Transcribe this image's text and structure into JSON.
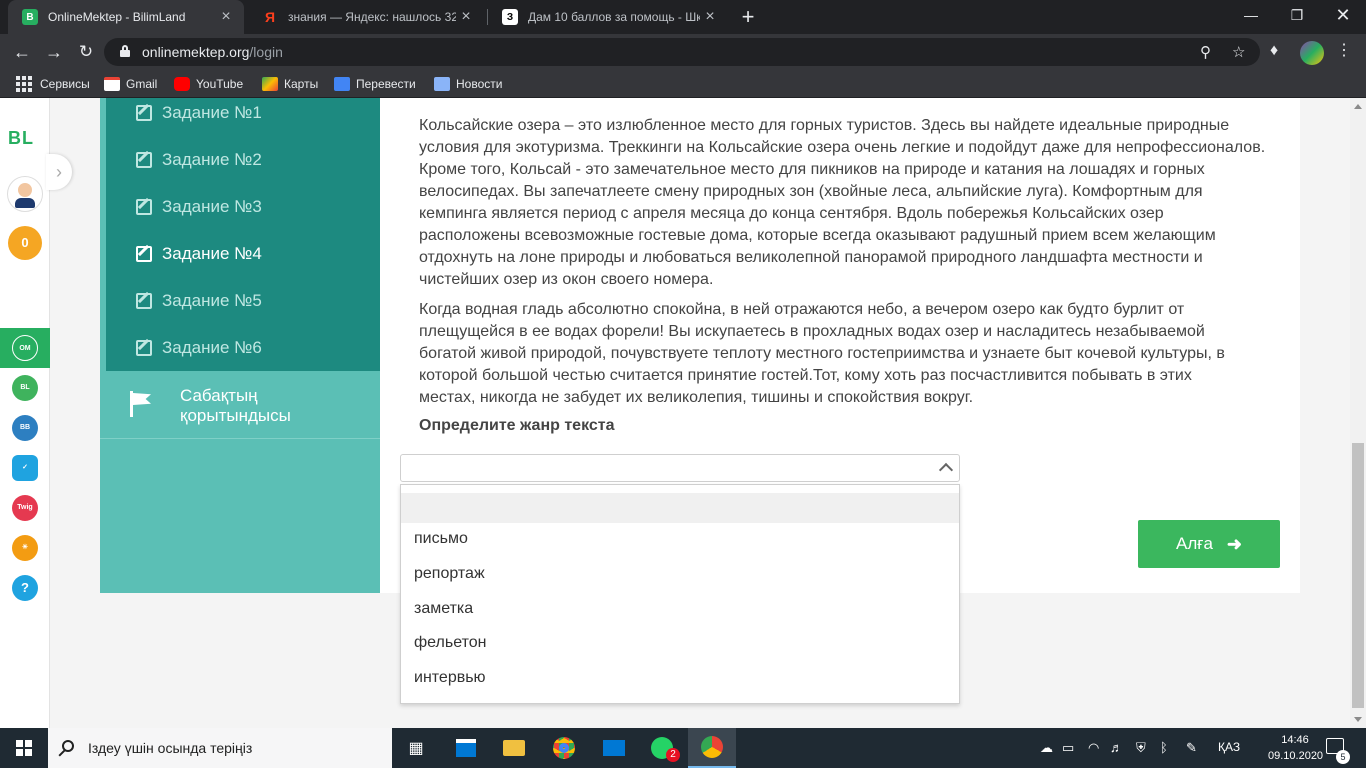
{
  "browser": {
    "tabs": [
      {
        "title": "OnlineMektep - BilimLand",
        "favicon": "B",
        "active": true
      },
      {
        "title": "знания — Яндекс: нашлось 32 м",
        "favicon": "Я",
        "active": false
      },
      {
        "title": "Дам 10 баллов за помощь - Шк",
        "favicon": "З",
        "active": false
      }
    ],
    "url_host": "onlinemektep.org",
    "url_path": "/login",
    "bookmarks": [
      "Сервисы",
      "Gmail",
      "YouTube",
      "Карты",
      "Перевести",
      "Новости"
    ]
  },
  "rail": {
    "logo": "BL",
    "coins": "0"
  },
  "sidebar": {
    "tasks": [
      "Задание №1",
      "Задание №2",
      "Задание №3",
      "Задание №4",
      "Задание №5",
      "Задание №6"
    ],
    "current_task_index": 3,
    "summary_label": "Сабақтың қорытындысы"
  },
  "content": {
    "paragraph1": "Кольсайские озера – это излюбленное место для горных туристов. Здесь вы найдете идеальные природные условия для экотуризма. Треккинги на Кольсайские озера очень легкие и подойдут даже для непрофессионалов. Кроме того, Кольсай - это замечательное место для пикников на природе и катания на лошадях и горных велосипедах. Вы запечатлеете смену природных зон (хвойные леса, альпийские луга). Комфортным для кемпинга является период с апреля месяца до конца сентября. Вдоль побережья Кольсайских озер расположены всевозможные гостевые дома, которые всегда оказывают радушный прием всем желающим отдохнуть на лоне природы и любоваться великолепной панорамой природного ландшафта местности и чистейших озер из окон своего номера.",
    "paragraph2": "Когда водная гладь абсолютно спокойна, в ней отражаются небо, а вечером озеро как будто бурлит от плещущейся в ее водах форели! Вы искупаетесь в прохладных водах озер и насладитесь незабываемой богатой живой природой, почувствуете теплоту местного гостеприимства и узнаете быт кочевой культуры, в которой большой честью считается принятие гостей.Тот, кому хоть раз посчастливится побывать в этих местах, никогда не забудет их великолепия, тишины и спокойствия вокруг.",
    "question": "Определите жанр текста",
    "select_value": "",
    "options": [
      "",
      "письмо",
      "репортаж",
      "заметка",
      "фельетон",
      "интервью"
    ],
    "next_button": "Алға"
  },
  "taskbar": {
    "search_placeholder": "Іздеу үшін осында теріңіз",
    "whatsapp_badge": "2",
    "language": "ҚАЗ",
    "time": "14:46",
    "date": "09.10.2020",
    "notifications": "5"
  },
  "colors": {
    "sidebar_dark": "#1d8a80",
    "sidebar_light": "#5bbfb5",
    "button_green": "#3bb75e"
  }
}
